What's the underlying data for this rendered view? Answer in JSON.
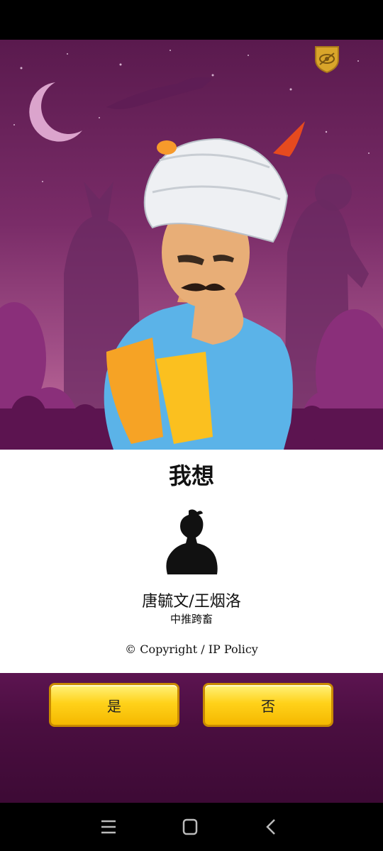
{
  "result": {
    "heading": "我想",
    "name": "唐毓文/王烟洛",
    "description": "中推跨畜",
    "copyright": "© Copyright / IP Policy"
  },
  "buttons": {
    "yes": "是",
    "no": "否"
  },
  "icons": {
    "privacy": "privacy-shield-icon",
    "nav_menu": "recent-apps-icon",
    "nav_home": "home-icon",
    "nav_back": "back-icon"
  },
  "colors": {
    "scene_purple": "#7a2c68",
    "button_yellow": "#ffd21a",
    "badge_gold": "#d9a52a"
  }
}
